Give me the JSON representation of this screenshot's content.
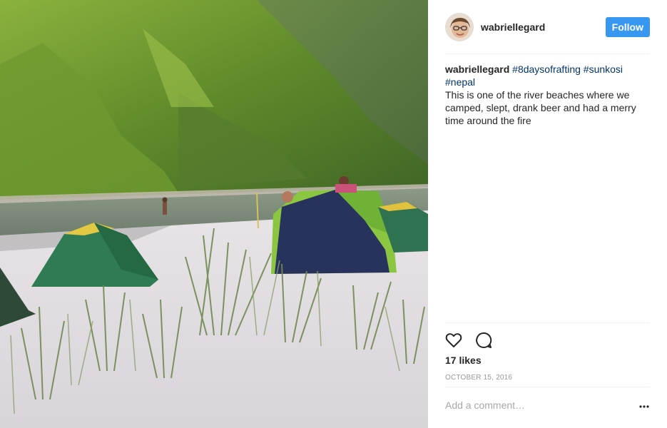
{
  "post": {
    "username": "wabriellegard",
    "follow_label": "Follow",
    "caption": {
      "user": "wabriellegard",
      "hashtags": [
        "#8daysofrafting",
        "#sunkosi",
        "#nepal"
      ],
      "text": "This is one of the river beaches where we camped, slept, drank beer and had a merry time around the fire"
    },
    "likes": "17 likes",
    "date": "OCTOBER 15, 2016",
    "comment_placeholder": "Add a comment…"
  },
  "icons": {
    "like": "heart-icon",
    "comment": "comment-icon",
    "more": "more-options-icon"
  },
  "colors": {
    "follow_button": "#3897f0",
    "hashtag": "#003569",
    "meta_text": "#999999"
  }
}
